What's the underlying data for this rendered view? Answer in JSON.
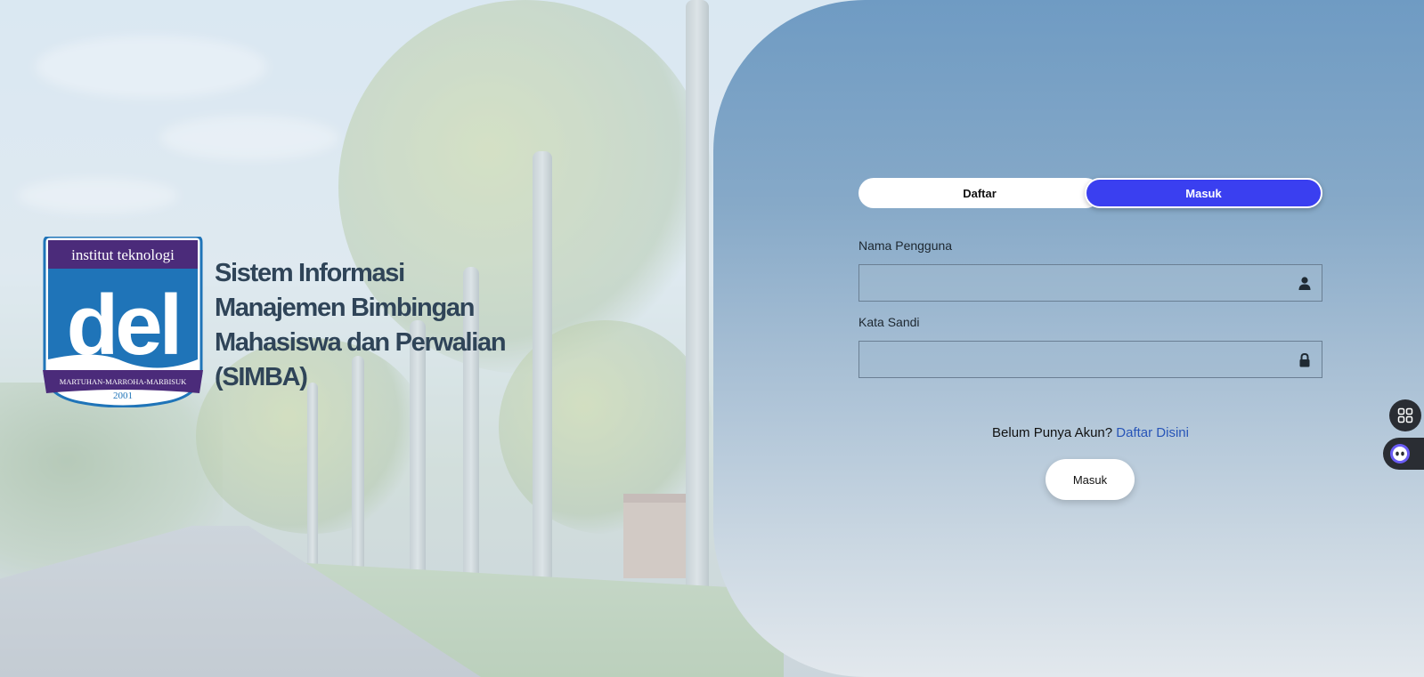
{
  "brand": {
    "logo": {
      "top_text": "institut teknologi",
      "main_text": "del",
      "ribbon_text": "MARTUHAN-MARROHA-MARBISUK",
      "year": "2001"
    },
    "title_lines": [
      "Sistem Informasi",
      "Manajemen Bimbingan",
      "Mahasiswa dan Perwalian",
      "(SIMBA)"
    ]
  },
  "tabs": {
    "daftar": "Daftar",
    "masuk": "Masuk",
    "active": "masuk"
  },
  "form": {
    "username_label": "Nama Pengguna",
    "username_value": "",
    "username_icon": "user-icon",
    "password_label": "Kata Sandi",
    "password_value": "",
    "password_icon": "lock-icon",
    "signup_prompt": "Belum Punya Akun?",
    "signup_link": "Daftar Disini",
    "submit_label": "Masuk"
  },
  "floating": {
    "grid_icon": "apps-grid-icon",
    "assistant_icon": "assistant-bot-icon"
  },
  "colors": {
    "active_tab": "#3a3ff0",
    "link": "#2855b8",
    "title": "#2f4458",
    "logo_blue": "#1f74b8",
    "logo_purple": "#4b2b7a"
  }
}
